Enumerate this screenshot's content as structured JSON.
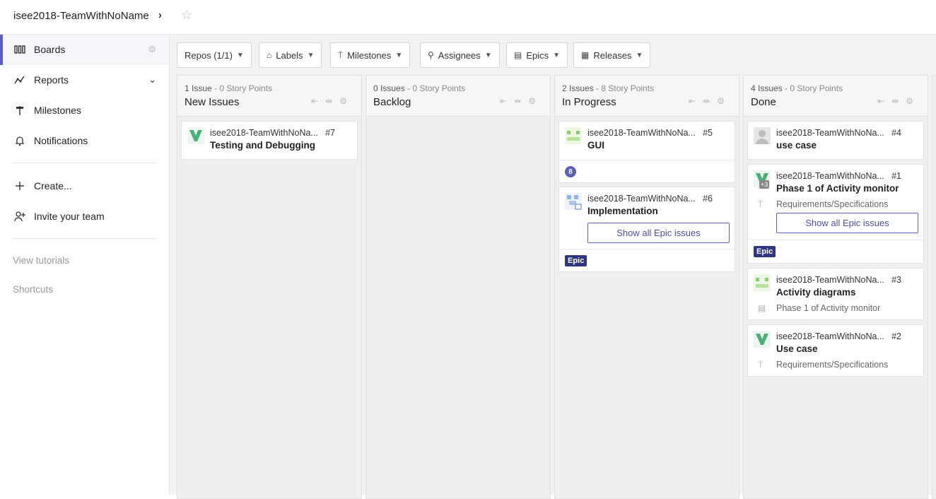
{
  "header": {
    "workspace": "isee2018-TeamWithNoName",
    "chevron": "›",
    "star": "☆"
  },
  "sidebar": {
    "items": [
      {
        "label": "Boards",
        "icon": "board-icon",
        "right": "⚙"
      },
      {
        "label": "Reports",
        "icon": "reports-icon",
        "right": "⌄"
      },
      {
        "label": "Milestones",
        "icon": "milestone-icon"
      },
      {
        "label": "Notifications",
        "icon": "bell-icon"
      },
      {
        "label": "Create...",
        "icon": "plus-icon"
      },
      {
        "label": "Invite your team",
        "icon": "add-user-icon"
      }
    ],
    "links": [
      "View tutorials",
      "Shortcuts"
    ]
  },
  "filters": [
    {
      "label": "Repos (1/1)"
    },
    {
      "label": "Labels",
      "icon": "⌂"
    },
    {
      "label": "Milestones",
      "icon": "⍑"
    },
    {
      "label": "Assignees",
      "icon": "⚲"
    },
    {
      "label": "Epics",
      "icon": "▤"
    },
    {
      "label": "Releases",
      "icon": "▦"
    }
  ],
  "columns": [
    {
      "count": "1 Issue",
      "points": " - 0 Story Points",
      "title": "New Issues"
    },
    {
      "count": "0 Issues",
      "points": " - 0 Story Points",
      "title": "Backlog"
    },
    {
      "count": "2 Issues",
      "points": " - 8 Story Points",
      "title": "In Progress"
    },
    {
      "count": "4 Issues",
      "points": " - 0 Story Points",
      "title": "Done"
    }
  ],
  "cards": {
    "c7": {
      "repo": "isee2018-TeamWithNoNa...",
      "num": "#7",
      "title": "Testing and Debugging"
    },
    "c5": {
      "repo": "isee2018-TeamWithNoNa...",
      "num": "#5",
      "title": "GUI",
      "estimate": "8"
    },
    "c6": {
      "repo": "isee2018-TeamWithNoNa...",
      "num": "#6",
      "title": "Implementation",
      "button": "Show all Epic issues",
      "badge": "Epic"
    },
    "c4": {
      "repo": "isee2018-TeamWithNoNa...",
      "num": "#4",
      "title": "use case"
    },
    "c1": {
      "repo": "isee2018-TeamWithNoNa...",
      "num": "#1",
      "title": "Phase 1 of Activity monitor",
      "plus": "+3",
      "meta": "Requirements/Specifications",
      "button": "Show all Epic issues",
      "badge": "Epic"
    },
    "c3": {
      "repo": "isee2018-TeamWithNoNa...",
      "num": "#3",
      "title": "Activity diagrams",
      "meta": "Phase 1 of Activity monitor"
    },
    "c2": {
      "repo": "isee2018-TeamWithNoNa...",
      "num": "#2",
      "title": "Use case",
      "meta": "Requirements/Specifications"
    }
  },
  "colors": {
    "accent": "#5a5fba",
    "epic": "#2f3580",
    "avatar_green": "#4caf7a"
  }
}
